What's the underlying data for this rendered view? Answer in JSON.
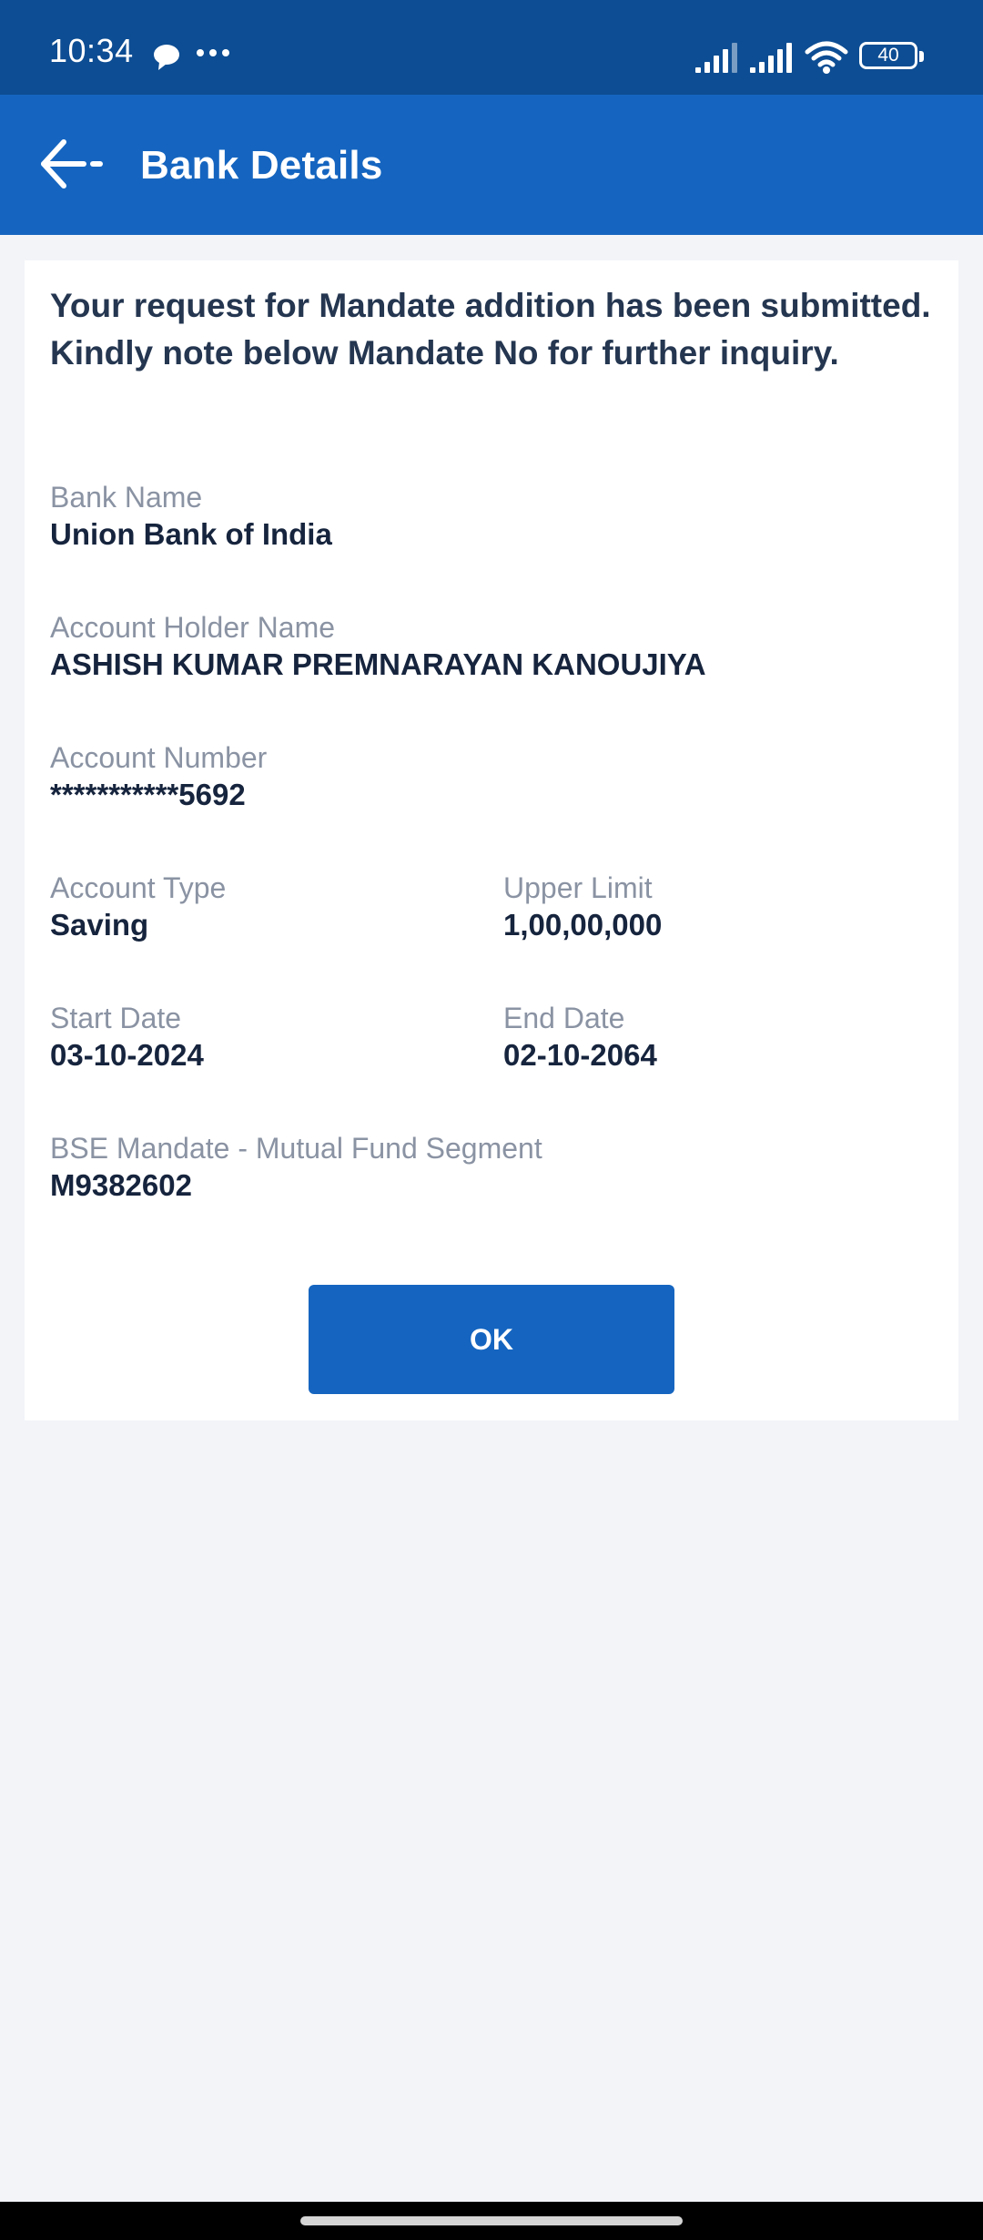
{
  "status_bar": {
    "time": "10:34",
    "battery": "40",
    "icons": [
      "chat-bubble-icon",
      "more-dots-icon",
      "signal-icon",
      "signal-icon",
      "wifi-icon",
      "battery-icon"
    ]
  },
  "app_bar": {
    "title": "Bank Details",
    "back_icon": "arrow-left-icon"
  },
  "confirmation": {
    "message": "Your request for Mandate addition has been submitted. Kindly note below Mandate No for further inquiry."
  },
  "fields": {
    "bank_name": {
      "label": "Bank Name",
      "value": "Union Bank of India"
    },
    "account_holder": {
      "label": "Account Holder Name",
      "value": "ASHISH KUMAR PREMNARAYAN KANOUJIYA"
    },
    "account_number": {
      "label": "Account Number",
      "value": "***********5692"
    },
    "account_type": {
      "label": "Account Type",
      "value": "Saving"
    },
    "upper_limit": {
      "label": "Upper Limit",
      "value": "1,00,00,000"
    },
    "start_date": {
      "label": "Start Date",
      "value": "03-10-2024"
    },
    "end_date": {
      "label": "End Date",
      "value": "02-10-2064"
    },
    "mandate": {
      "label": "BSE Mandate - Mutual Fund Segment",
      "value": "M9382602"
    }
  },
  "actions": {
    "ok_label": "OK"
  },
  "colors": {
    "status_bar": "#0d4d93",
    "app_bar": "#1565c0",
    "primary_button": "#1565c0",
    "page_background": "#f2f4f8"
  }
}
